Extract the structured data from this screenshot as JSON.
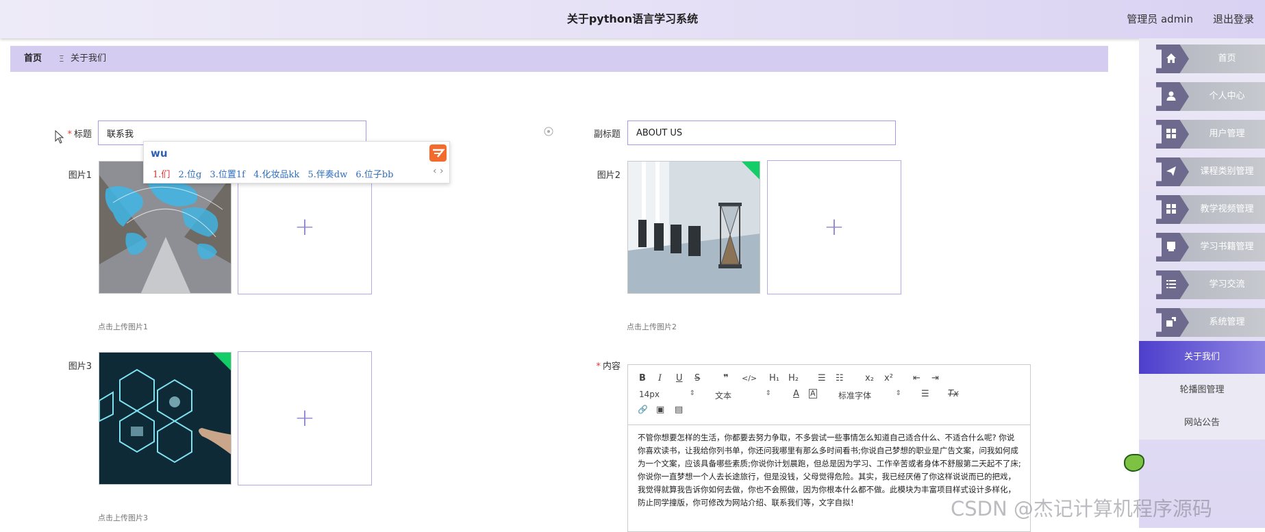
{
  "header": {
    "title": "关于python语言学习系统",
    "user_label": "管理员 admin",
    "logout_label": "退出登录"
  },
  "breadcrumb": {
    "home": "首页",
    "separator": "Ξ",
    "current": "关于我们"
  },
  "sidebar": {
    "items": [
      {
        "label": "首页",
        "icon": "home-icon"
      },
      {
        "label": "个人中心",
        "icon": "user-icon"
      },
      {
        "label": "用户管理",
        "icon": "grid-icon"
      },
      {
        "label": "课程类别管理",
        "icon": "send-icon"
      },
      {
        "label": "教学视频管理",
        "icon": "grid-icon"
      },
      {
        "label": "学习书籍管理",
        "icon": "book-icon"
      },
      {
        "label": "学习交流",
        "icon": "list-icon"
      },
      {
        "label": "系统管理",
        "icon": "gear-icon"
      }
    ],
    "submenu": [
      {
        "label": "关于我们",
        "active": true
      },
      {
        "label": "轮播图管理",
        "active": false
      },
      {
        "label": "网站公告",
        "active": false
      }
    ]
  },
  "form": {
    "title_label": "标题",
    "title_value": "联系我",
    "subtitle_label": "副标题",
    "subtitle_value": "ABOUT US",
    "image1_label": "图片1",
    "image1_hint": "点击上传图片1",
    "image2_label": "图片2",
    "image2_hint": "点击上传图片2",
    "image3_label": "图片3",
    "image3_hint": "点击上传图片3",
    "content_label": "内容",
    "upload_plus": "+"
  },
  "ime": {
    "pinyin": "wu",
    "candidates": [
      "1.们",
      "2.位g",
      "3.位置1f",
      "4.化妆品kk",
      "5.伴奏dw",
      "6.位子bb"
    ],
    "pager": "‹ ›"
  },
  "editor": {
    "toolbar": {
      "bold": "B",
      "italic": "I",
      "underline": "U",
      "strike": "S",
      "quote": "❞",
      "code": "</>",
      "h1": "H₁",
      "h2": "H₂",
      "ol": "☰",
      "ul": "☷",
      "sub": "x₂",
      "sup": "x²",
      "outdent": "⇤",
      "indent": "⇥",
      "font_size": "14px",
      "format": "文本",
      "font_family": "标准字体",
      "color": "A",
      "bg": "A",
      "align": "☰",
      "clean": "Tx",
      "link": "🔗",
      "image": "▣",
      "video": "▤"
    },
    "content": "不管你想要怎样的生活，你都要去努力争取，不多尝试一些事情怎么知道自己适合什么、不适合什么呢? 你说你喜欢读书，让我给你列书单，你还问我哪里有那么多时间看书;你说自己梦想的职业是广告文案，问我如何成为一个文案，应该具备哪些素质;你说你计划晨跑，但总是因为学习、工作辛苦或者身体不舒服第二天起不了床;你说你一直梦想一个人去长途旅行，但是没钱，父母觉得危险。其实，我已经厌倦了你这样说说而已的把戏，我觉得就算我告诉你如何去做，你也不会照做，因为你根本什么都不做。此模块为丰富项目样式设计多样化，防止同学撞版，你可修改为网站介绍、联系我们等，文字自拟！"
  },
  "watermark": "CSDN @杰记计算机程序源码",
  "colors": {
    "accent": "#5b4fd0",
    "required": "#e53935",
    "success_tag": "#13ce66",
    "input_border": "#a49be0"
  }
}
